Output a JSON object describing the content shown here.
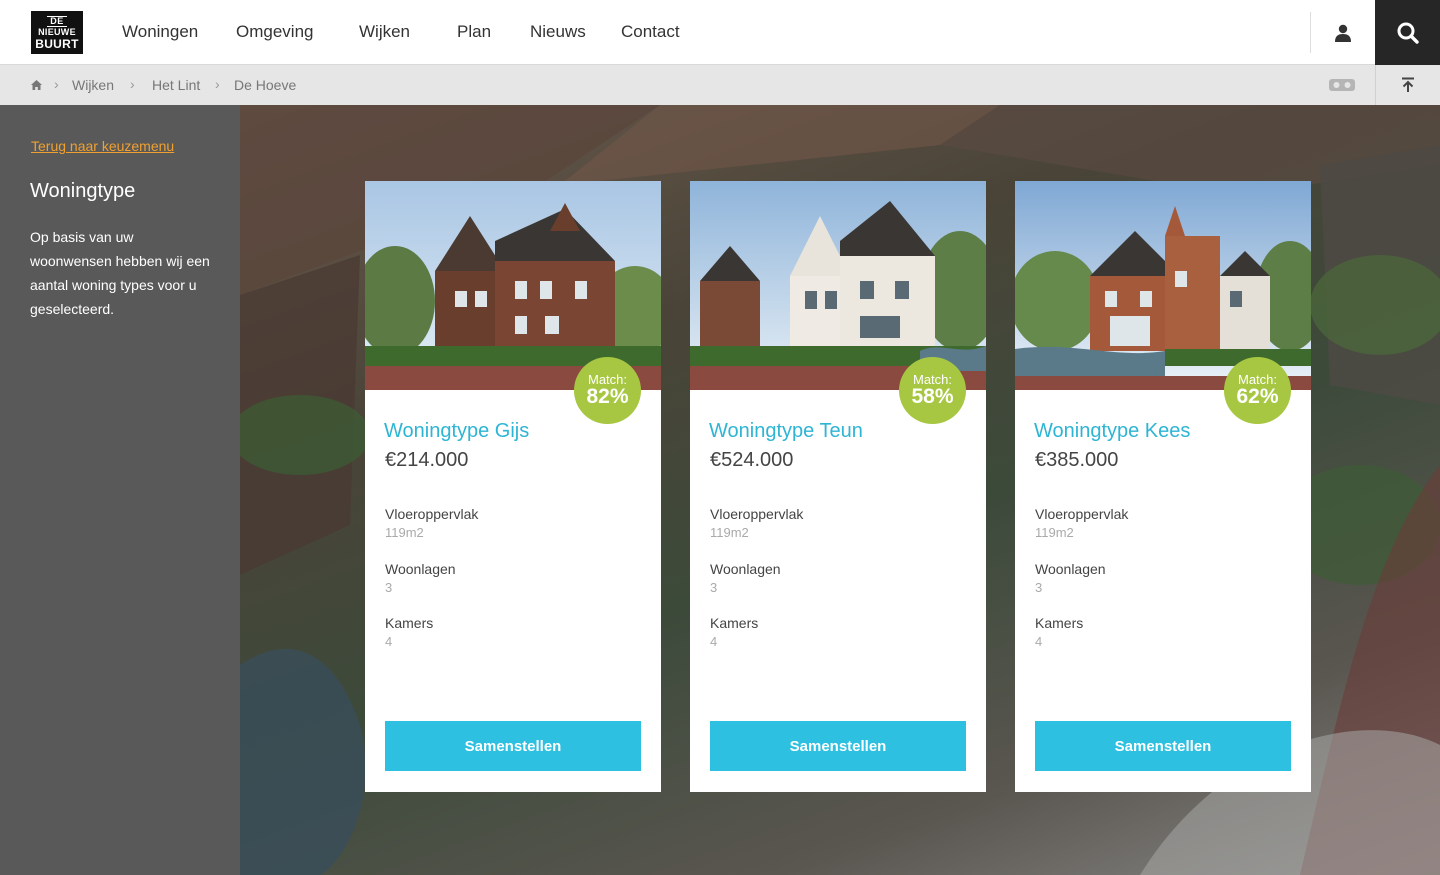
{
  "brand": {
    "line1": "DE",
    "line2": "NIEUWE",
    "line3": "BUURT"
  },
  "nav": [
    "Woningen",
    "Omgeving",
    "Wijken",
    "Plan",
    "Nieuws",
    "Contact"
  ],
  "header_icons": {
    "account": "user-icon",
    "search": "search-icon"
  },
  "breadcrumb": {
    "home_icon": "home-icon",
    "items": [
      "Wijken",
      "Het Lint",
      "De Hoeve"
    ],
    "separator": "›"
  },
  "breadcrumb_icons": {
    "vr": "vr-goggles-icon",
    "back_to_top": "arrow-up-to-top-icon"
  },
  "sidebar": {
    "back_link": "Terug naar keuzemenu",
    "title": "Woningtype",
    "text": "Op basis van uw woonwensen hebben wij een aantal woning types voor u geselecteerd."
  },
  "cards": [
    {
      "title": "Woningtype Gijs",
      "price": "€214.000",
      "match_label": "Match:",
      "match_value": "82%",
      "specs": [
        {
          "label": "Vloeroppervlak",
          "value": "119m2"
        },
        {
          "label": "Woonlagen",
          "value": "3"
        },
        {
          "label": "Kamers",
          "value": "4"
        }
      ],
      "button": "Samenstellen"
    },
    {
      "title": "Woningtype Teun",
      "price": "€524.000",
      "match_label": "Match:",
      "match_value": "58%",
      "specs": [
        {
          "label": "Vloeroppervlak",
          "value": "119m2"
        },
        {
          "label": "Woonlagen",
          "value": "3"
        },
        {
          "label": "Kamers",
          "value": "4"
        }
      ],
      "button": "Samenstellen"
    },
    {
      "title": "Woningtype Kees",
      "price": "€385.000",
      "match_label": "Match:",
      "match_value": "62%",
      "specs": [
        {
          "label": "Vloeroppervlak",
          "value": "119m2"
        },
        {
          "label": "Woonlagen",
          "value": "3"
        },
        {
          "label": "Kamers",
          "value": "4"
        }
      ],
      "button": "Samenstellen"
    }
  ],
  "colors": {
    "accent": "#2ec0e0",
    "match": "#a7c742",
    "link": "#f0a030",
    "sidebar": "#595959"
  }
}
